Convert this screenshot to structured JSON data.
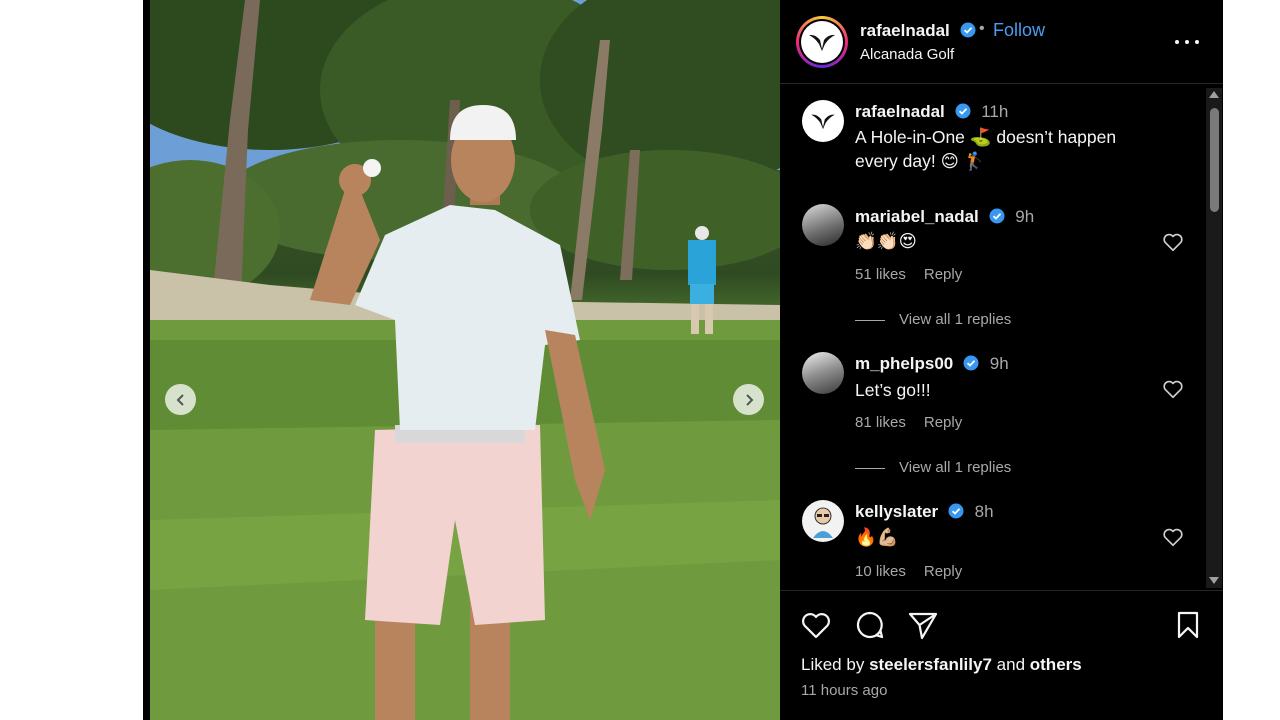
{
  "post": {
    "author": "rafaelnadal",
    "separator": "•",
    "follow_label": "Follow",
    "location": "Alcanada Golf",
    "caption_time": "11h",
    "caption_line1": "A Hole-in-One ⛳ doesn’t happen",
    "caption_line2": "every day! 😊 🏌️"
  },
  "comments": [
    {
      "user": "mariabel_nadal",
      "time": "9h",
      "text": "👏🏻👏🏻😍",
      "likes": "51 likes",
      "reply": "Reply",
      "replies": "View all 1 replies"
    },
    {
      "user": "m_phelps00",
      "time": "9h",
      "text": "Let’s go!!!",
      "likes": "81 likes",
      "reply": "Reply",
      "replies": "View all 1 replies"
    },
    {
      "user": "kellyslater",
      "time": "8h",
      "text": "🔥💪🏼",
      "likes": "10 likes",
      "reply": "Reply"
    }
  ],
  "footer": {
    "liked_by_prefix": "Liked by",
    "liked_by_user": "steelersfanlily7",
    "liked_by_and": "and",
    "liked_by_others": "others",
    "time_ago": "11 hours ago"
  },
  "icons": {
    "like": "heart-icon",
    "comment": "comment-icon",
    "share": "share-icon",
    "save": "bookmark-icon",
    "more": "more-options-icon",
    "verified": "verified-badge-icon",
    "prev": "chevron-left-icon",
    "next": "chevron-right-icon"
  },
  "colors": {
    "accent_link": "#4a9df0",
    "verified": "#3897f0",
    "panel_bg": "#000000",
    "muted_text": "#a8a8a8"
  }
}
